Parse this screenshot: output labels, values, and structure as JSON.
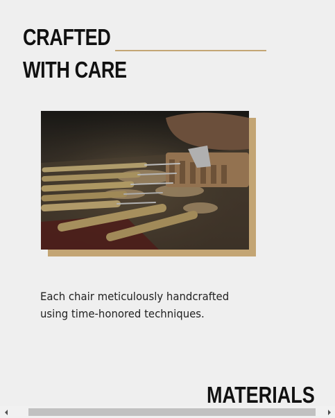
{
  "section": {
    "heading_line1": "CRAFTED",
    "heading_line2": "WITH CARE",
    "caption_line1": "Each chair meticulously handcrafted",
    "caption_line2": "using time-honored techniques."
  },
  "next_section": {
    "heading": "MATERIALS"
  },
  "image": {
    "alt": "Woodworking chisels and carving tools on a workbench with wood shavings",
    "accent_color": "#c3a574"
  },
  "scrollbar": {
    "orientation": "horizontal"
  }
}
